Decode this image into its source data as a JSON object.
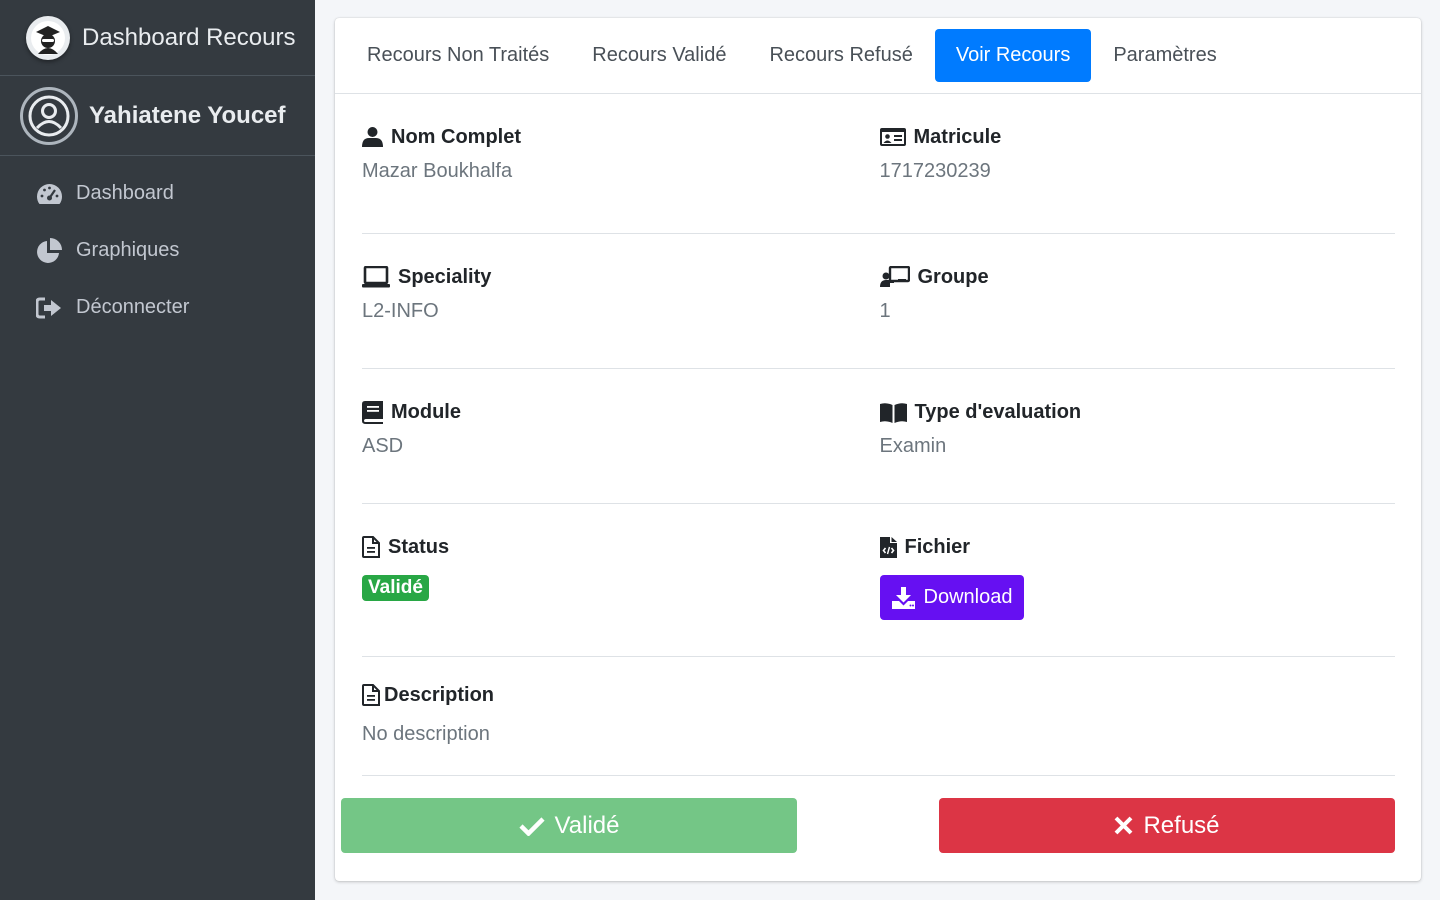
{
  "sidebar": {
    "brand": "Dashboard Recours",
    "user_name": "Yahiatene Youcef",
    "nav": [
      {
        "label": "Dashboard",
        "icon": "tachometer-icon"
      },
      {
        "label": "Graphiques",
        "icon": "pie-chart-icon"
      },
      {
        "label": "Déconnecter",
        "icon": "sign-out-icon"
      }
    ]
  },
  "tabs": [
    {
      "label": "Recours Non Traités",
      "active": false
    },
    {
      "label": "Recours Validé",
      "active": false
    },
    {
      "label": "Recours Refusé",
      "active": false
    },
    {
      "label": "Voir Recours",
      "active": true
    },
    {
      "label": "Paramètres",
      "active": false
    }
  ],
  "details": {
    "nom_label": "Nom Complet",
    "nom_value": "Mazar Boukhalfa",
    "matricule_label": "Matricule",
    "matricule_value": "1717230239",
    "speciality_label": "Speciality",
    "speciality_value": "L2-INFO",
    "groupe_label": "Groupe",
    "groupe_value": "1",
    "module_label": "Module",
    "module_value": "ASD",
    "type_label": "Type d'evaluation",
    "type_value": "Examin",
    "status_label": "Status",
    "status_value": "Validé",
    "fichier_label": "Fichier",
    "download_label": "Download",
    "description_label": "Description",
    "description_value": "No description"
  },
  "actions": {
    "valid_label": "Validé",
    "refuse_label": "Refusé"
  },
  "colors": {
    "sidebar_bg": "#343a40",
    "primary": "#007bff",
    "success": "#28a745",
    "indigo": "#6610f2",
    "danger": "#dc3545",
    "success_light": "#74c686"
  }
}
